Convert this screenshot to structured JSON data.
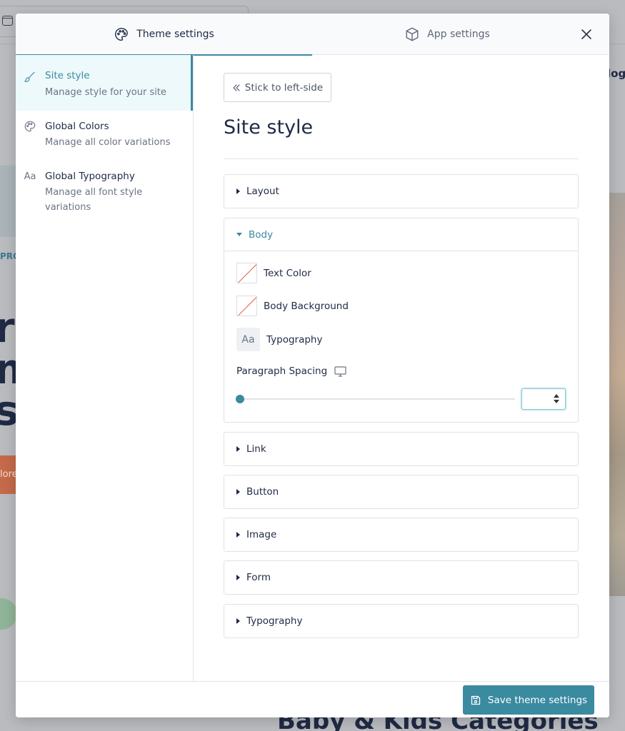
{
  "background": {
    "pro_text": "PRC",
    "big_letters": [
      "r",
      "m",
      "s("
    ],
    "orange_button_text": "lore",
    "right_partial_text": "log",
    "footer_heading": "Baby & Kids Categories"
  },
  "modal": {
    "tabs": [
      {
        "label": "Theme settings",
        "icon": "palette-icon",
        "active": true
      },
      {
        "label": "App settings",
        "icon": "box-icon",
        "active": false
      }
    ],
    "close_icon": "close-icon",
    "sidebar": {
      "items": [
        {
          "title": "Site style",
          "desc": "Manage style for your site",
          "icon": "brush-icon",
          "active": true
        },
        {
          "title": "Global Colors",
          "desc": "Manage all color variations",
          "icon": "palette-icon",
          "active": false
        },
        {
          "title": "Global Typography",
          "desc": "Manage all font style variations",
          "icon": "typography-icon",
          "active": false
        }
      ]
    },
    "main": {
      "stick_button": "Stick to left-side",
      "title": "Site style",
      "sections": [
        {
          "label": "Layout",
          "expanded": false
        },
        {
          "label": "Body",
          "expanded": true
        },
        {
          "label": "Link",
          "expanded": false
        },
        {
          "label": "Button",
          "expanded": false
        },
        {
          "label": "Image",
          "expanded": false
        },
        {
          "label": "Form",
          "expanded": false
        },
        {
          "label": "Typography",
          "expanded": false
        }
      ],
      "body": {
        "text_color_label": "Text Color",
        "background_label": "Body Background",
        "typography_label": "Typography",
        "typography_icon_text": "Aa",
        "paragraph_spacing_label": "Paragraph Spacing",
        "paragraph_spacing_value": "",
        "slider_value_fraction": 0
      }
    },
    "footer": {
      "save_label": "Save theme settings"
    },
    "colors": {
      "accent": "#3a8aa0",
      "active_bg": "#edf9fb",
      "swatch_slash": "#e0603e"
    }
  }
}
